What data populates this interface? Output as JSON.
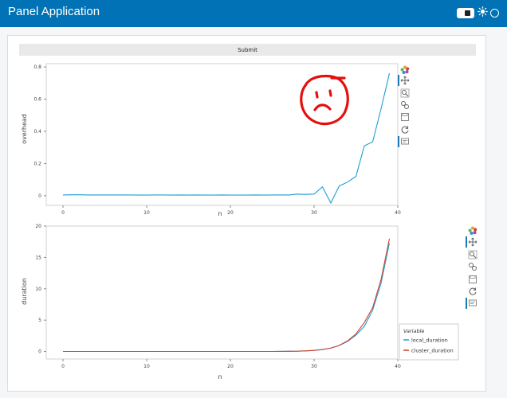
{
  "app": {
    "title": "Panel Application"
  },
  "submit": {
    "label": "Submit"
  },
  "colors": {
    "header": "#0072b5",
    "local": "#1f9ed1",
    "cluster": "#d6402b",
    "face": "#e3100e"
  },
  "charts": {
    "overhead": {
      "type": "line",
      "xlabel": "n",
      "ylabel": "overhead",
      "xlim": [
        -2,
        40
      ],
      "ylim": [
        -0.06,
        0.82
      ],
      "xticks": [
        0,
        10,
        20,
        30,
        40
      ],
      "yticks": [
        0,
        0.2,
        0.4,
        0.6,
        0.8
      ],
      "ytick_labels": [
        "0",
        "0.2",
        "0.4",
        "0.6",
        "0.8"
      ],
      "series": [
        {
          "x": [
            0,
            1,
            2,
            3,
            4,
            5,
            6,
            7,
            8,
            9,
            10,
            11,
            12,
            13,
            14,
            15,
            16,
            17,
            18,
            19,
            20,
            21,
            22,
            23,
            24,
            25,
            26,
            27,
            28,
            29,
            30,
            31,
            32,
            33,
            34,
            35,
            36,
            37,
            38,
            39
          ],
          "values": [
            0.005,
            0.006,
            0.006,
            0.005,
            0.005,
            0.005,
            0.005,
            0.005,
            0.005,
            0.004,
            0.004,
            0.005,
            0.005,
            0.004,
            0.005,
            0.004,
            0.005,
            0.004,
            0.004,
            0.005,
            0.004,
            0.004,
            0.004,
            0.005,
            0.004,
            0.005,
            0.005,
            0.005,
            0.01,
            0.008,
            0.01,
            0.055,
            -0.045,
            0.06,
            0.085,
            0.12,
            0.31,
            0.335,
            0.54,
            0.76
          ]
        }
      ]
    },
    "duration": {
      "type": "line",
      "xlabel": "n",
      "ylabel": "duration",
      "xlim": [
        -2,
        40
      ],
      "ylim": [
        -1.2,
        20
      ],
      "xticks": [
        0,
        10,
        20,
        30,
        40
      ],
      "yticks": [
        0,
        5,
        10,
        15,
        20
      ],
      "ytick_labels": [
        "0",
        "5",
        "10",
        "15",
        "20"
      ],
      "legend": {
        "title": "Variable",
        "position": "bottom-right"
      },
      "series": [
        {
          "name": "local_duration",
          "x": [
            0,
            1,
            2,
            3,
            4,
            5,
            6,
            7,
            8,
            9,
            10,
            11,
            12,
            13,
            14,
            15,
            16,
            17,
            18,
            19,
            20,
            21,
            22,
            23,
            24,
            25,
            26,
            27,
            28,
            29,
            30,
            31,
            32,
            33,
            34,
            35,
            36,
            37,
            38,
            39
          ],
          "values": [
            0,
            0,
            0,
            0,
            0,
            0,
            0,
            0,
            0,
            0,
            0,
            0,
            0,
            0,
            0,
            0,
            0,
            0,
            0,
            0,
            0,
            0,
            0,
            0,
            0.01,
            0.01,
            0.02,
            0.03,
            0.05,
            0.09,
            0.17,
            0.3,
            0.55,
            0.95,
            1.6,
            2.6,
            4.0,
            6.6,
            10.9,
            17.3
          ]
        },
        {
          "name": "cluster_duration",
          "x": [
            0,
            1,
            2,
            3,
            4,
            5,
            6,
            7,
            8,
            9,
            10,
            11,
            12,
            13,
            14,
            15,
            16,
            17,
            18,
            19,
            20,
            21,
            22,
            23,
            24,
            25,
            26,
            27,
            28,
            29,
            30,
            31,
            32,
            33,
            34,
            35,
            36,
            37,
            38,
            39
          ],
          "values": [
            0,
            0,
            0,
            0,
            0,
            0,
            0,
            0,
            0,
            0,
            0,
            0,
            0,
            0,
            0,
            0,
            0,
            0,
            0,
            0,
            0,
            0,
            0,
            0,
            0.01,
            0.01,
            0.02,
            0.03,
            0.05,
            0.09,
            0.17,
            0.32,
            0.53,
            0.97,
            1.7,
            2.8,
            4.6,
            7.0,
            11.5,
            18.0
          ]
        }
      ]
    }
  }
}
